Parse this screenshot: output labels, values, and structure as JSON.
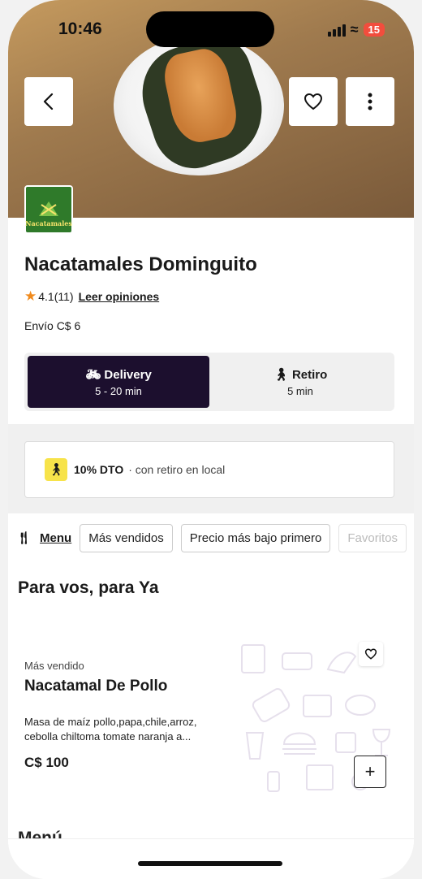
{
  "status_bar": {
    "time": "10:46",
    "battery": "15"
  },
  "store": {
    "name": "Nacatamales Dominguito",
    "logo_text": "Nacatamales",
    "rating": "4.1",
    "rating_count": "(11)",
    "reviews_link": "Leer opiniones",
    "shipping": "Envío C$ 6"
  },
  "delivery_modes": [
    {
      "label": "Delivery",
      "icon": "bike-icon",
      "time": "5 - 20 min",
      "active": true
    },
    {
      "label": "Retiro",
      "icon": "walk-icon",
      "time": "5 min",
      "active": false
    }
  ],
  "promo": {
    "strong": "10% DTO",
    "rest": "· con retiro en local",
    "icon": "walk-icon"
  },
  "filters": {
    "menu_label": "Menu",
    "chips": [
      "Más vendidos",
      "Precio más bajo primero",
      "Favoritos"
    ]
  },
  "section_title": "Para vos, para Ya",
  "product": {
    "badge": "Más vendido",
    "name": "Nacatamal De Pollo",
    "description": "Masa de maíz pollo,papa,chile,arroz, cebolla chiltoma tomate naranja a...",
    "price": "C$ 100"
  },
  "next_section_title": "Menú",
  "colors": {
    "accent_dark": "#1c0f2e",
    "promo_yellow": "#f7e34a",
    "star": "#f08a1c"
  }
}
